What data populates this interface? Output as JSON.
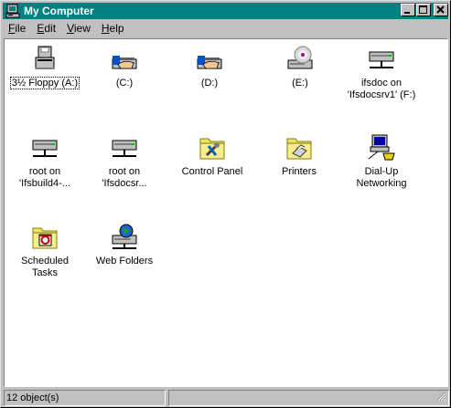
{
  "window": {
    "title": "My Computer",
    "buttons": {
      "minimize": "_",
      "maximize": "□",
      "close": "×"
    }
  },
  "menubar": {
    "items": [
      {
        "label": "File",
        "accel": "F",
        "rest": "ile"
      },
      {
        "label": "Edit",
        "accel": "E",
        "rest": "dit"
      },
      {
        "label": "View",
        "accel": "V",
        "rest": "iew"
      },
      {
        "label": "Help",
        "accel": "H",
        "rest": "elp"
      }
    ]
  },
  "items": [
    {
      "label": "3½ Floppy (A:)",
      "icon": "floppy-drive-icon"
    },
    {
      "label": "(C:)",
      "icon": "shared-hard-drive-icon"
    },
    {
      "label": "(D:)",
      "icon": "shared-hard-drive-icon"
    },
    {
      "label": "(E:)",
      "icon": "cdrom-drive-icon"
    },
    {
      "label": "ifsdoc on\n'Ifsdocsrv1' (F:)",
      "icon": "network-drive-icon"
    },
    {
      "label": "root on\n'Ifsbuild4-...",
      "icon": "network-drive-icon"
    },
    {
      "label": "root on\n'Ifsdocsr...",
      "icon": "network-drive-icon"
    },
    {
      "label": "Control Panel",
      "icon": "control-panel-folder-icon"
    },
    {
      "label": "Printers",
      "icon": "printers-folder-icon"
    },
    {
      "label": "Dial-Up\nNetworking",
      "icon": "dial-up-networking-icon"
    },
    {
      "label": "Scheduled\nTasks",
      "icon": "scheduled-tasks-folder-icon"
    },
    {
      "label": "Web Folders",
      "icon": "web-folders-icon"
    }
  ],
  "statusbar": {
    "count": "12 object(s)"
  }
}
